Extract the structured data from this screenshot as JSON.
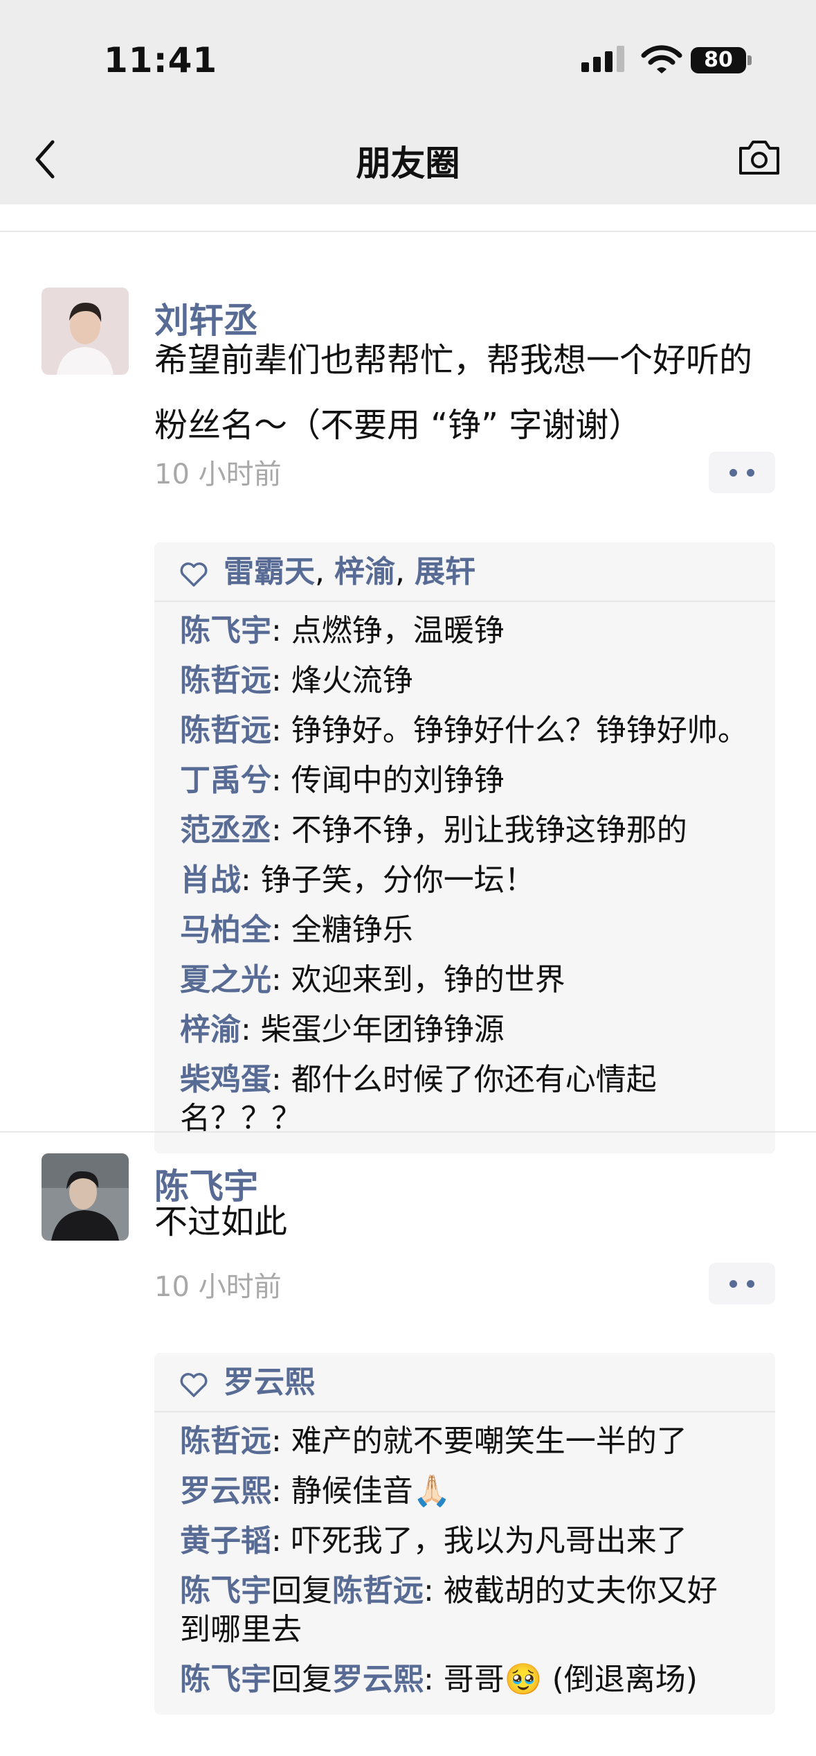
{
  "status": {
    "time": "11:41",
    "battery": "80"
  },
  "nav": {
    "title": "朋友圈"
  },
  "posts": [
    {
      "author": "刘轩丞",
      "content_line1": "希望前辈们也帮帮忙，帮我想一个好听的",
      "content_line2": "粉丝名～（不要用 “铮” 字谢谢）",
      "time": "10 小时前",
      "likes": [
        "雷霸天",
        "梓渝",
        "展轩"
      ],
      "likes_sep": ", ",
      "comments": [
        {
          "name": "陈飞宇",
          "text": ": 点燃铮，温暖铮"
        },
        {
          "name": "陈哲远",
          "text": ": 烽火流铮"
        },
        {
          "name": "陈哲远",
          "text": ": 铮铮好。铮铮好什么？铮铮好帅。"
        },
        {
          "name": "丁禹兮",
          "text": ": 传闻中的刘铮铮"
        },
        {
          "name": "范丞丞",
          "text": ": 不铮不铮，别让我铮这铮那的"
        },
        {
          "name": "肖战",
          "text": ": 铮子笑，分你一坛！"
        },
        {
          "name": "马柏全",
          "text": ": 全糖铮乐"
        },
        {
          "name": "夏之光",
          "text": ": 欢迎来到，铮的世界"
        },
        {
          "name": "梓渝",
          "text": ": 柴蛋少年团铮铮源"
        },
        {
          "name": "柴鸡蛋",
          "text": ": 都什么时候了你还有心情起",
          "text2": "名？？？"
        }
      ]
    },
    {
      "author": "陈飞宇",
      "content_line1": "不过如此",
      "time": "10 小时前",
      "likes": [
        "罗云熙"
      ],
      "comments": [
        {
          "name": "陈哲远",
          "text": ": 难产的就不要嘲笑生一半的了"
        },
        {
          "name": "罗云熙",
          "text": ": 静候佳音🙏🏻"
        },
        {
          "name": "黄子韬",
          "text": ": 吓死我了，我以为凡哥出来了"
        },
        {
          "name": "陈飞宇",
          "reply_word": "回复",
          "reply_to": "陈哲远",
          "text": ": 被截胡的丈夫你又好",
          "text2": "到哪里去"
        },
        {
          "name": "陈飞宇",
          "reply_word": "回复",
          "reply_to": "罗云熙",
          "text": ": 哥哥🥹 (倒退离场)"
        }
      ]
    }
  ],
  "colors": {
    "link": "#576b95",
    "header_bg": "#ededed",
    "comment_bg": "#f6f6f6",
    "time": "#a8a8a8"
  },
  "icons": [
    "back-arrow-icon",
    "camera-icon",
    "heart-icon",
    "more-dots-icon",
    "signal-icon",
    "wifi-icon",
    "battery-icon"
  ]
}
